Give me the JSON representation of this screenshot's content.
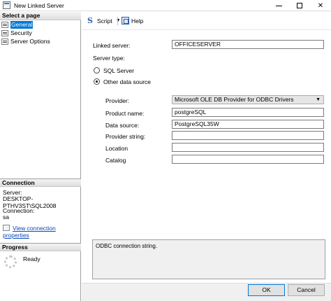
{
  "window": {
    "title": "New Linked Server"
  },
  "left_panel": {
    "select_page_header": "Select a page",
    "pages": [
      {
        "label": "General",
        "selected": true
      },
      {
        "label": "Security",
        "selected": false
      },
      {
        "label": "Server Options",
        "selected": false
      }
    ],
    "connection": {
      "header": "Connection",
      "server_label": "Server:",
      "server_value": "DESKTOP-PTHV3ST\\SQL2008",
      "connection_label": "Connection:",
      "connection_value": "sa",
      "view_link": "View connection properties"
    },
    "progress": {
      "header": "Progress",
      "status": "Ready"
    }
  },
  "toolbar": {
    "script_label": "Script",
    "help_label": "Help"
  },
  "form": {
    "linked_server_label": "Linked server:",
    "linked_server_value": "OFFICESERVER",
    "server_type_label": "Server type:",
    "server_type_options": [
      {
        "label": "SQL Server",
        "checked": false
      },
      {
        "label": "Other data source",
        "checked": true
      }
    ],
    "provider_label": "Provider:",
    "provider_value": "Microsoft OLE DB Provider for ODBC Drivers",
    "product_name_label": "Product name:",
    "product_name_value": "postgreSQL",
    "data_source_label": "Data source:",
    "data_source_value": "PostgreSQL35W",
    "provider_string_label": "Provider string:",
    "provider_string_value": "",
    "location_label": "Location",
    "location_value": "",
    "catalog_label": "Catalog",
    "catalog_value": "",
    "description": "ODBC connection string."
  },
  "buttons": {
    "ok": "OK",
    "cancel": "Cancel"
  }
}
